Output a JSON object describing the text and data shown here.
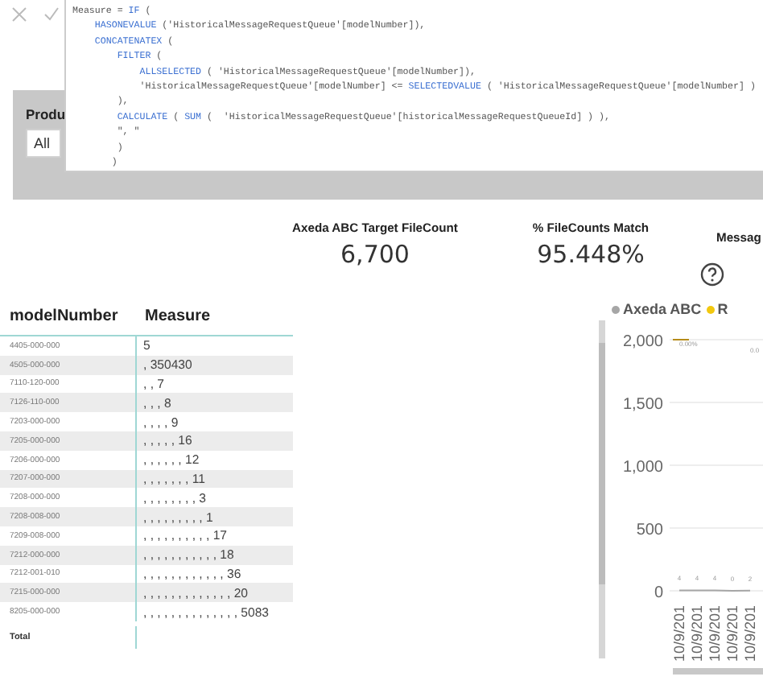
{
  "formula_bar": {
    "code_lines": [
      [
        {
          "kind": "plain",
          "text": "Measure = "
        },
        {
          "kind": "keyword",
          "text": "IF"
        },
        {
          "kind": "plain",
          "text": " ("
        }
      ],
      [
        {
          "kind": "keyword",
          "text": "    HASONEVALUE"
        },
        {
          "kind": "plain",
          "text": " ('HistoricalMessageRequestQueue'[modelNumber]),"
        }
      ],
      [
        {
          "kind": "keyword",
          "text": "    CONCATENATEX"
        },
        {
          "kind": "plain",
          "text": " ("
        }
      ],
      [
        {
          "kind": "keyword",
          "text": "        FILTER"
        },
        {
          "kind": "plain",
          "text": " ("
        }
      ],
      [
        {
          "kind": "keyword",
          "text": "            ALLSELECTED"
        },
        {
          "kind": "plain",
          "text": " ( 'HistoricalMessageRequestQueue'[modelNumber]),"
        }
      ],
      [
        {
          "kind": "plain",
          "text": "            'HistoricalMessageRequestQueue'[modelNumber] <= "
        },
        {
          "kind": "keyword",
          "text": "SELECTEDVALUE"
        },
        {
          "kind": "plain",
          "text": " ( 'HistoricalMessageRequestQueue'[modelNumber] )"
        }
      ],
      [
        {
          "kind": "plain",
          "text": "        ),"
        }
      ],
      [
        {
          "kind": "keyword",
          "text": "        CALCULATE"
        },
        {
          "kind": "plain",
          "text": " ( "
        },
        {
          "kind": "keyword",
          "text": "SUM"
        },
        {
          "kind": "plain",
          "text": " (  'HistoricalMessageRequestQueue'[historicalMessageRequestQueueId] ) ),"
        }
      ],
      [
        {
          "kind": "plain",
          "text": "        \", \""
        }
      ],
      [
        {
          "kind": "plain",
          "text": "        )"
        }
      ],
      [
        {
          "kind": "plain",
          "text": "       )"
        }
      ]
    ]
  },
  "slicer": {
    "title": "Produ",
    "value": "All"
  },
  "cards": [
    {
      "label": "Axeda ABC Target FileCount",
      "value": "6,700"
    },
    {
      "label": "% FileCounts Match",
      "value": "95.448%"
    },
    {
      "label": "Messag"
    }
  ],
  "table": {
    "columns": [
      "modelNumber",
      "Measure"
    ],
    "rows": [
      [
        "4405-000-000",
        "5"
      ],
      [
        "4505-000-000",
        ", 350430"
      ],
      [
        "7110-120-000",
        ", , 7"
      ],
      [
        "7126-110-000",
        ", , , 8"
      ],
      [
        "7203-000-000",
        ", , , , 9"
      ],
      [
        "7205-000-000",
        ", , , , , 16"
      ],
      [
        "7206-000-000",
        ", , , , , , 12"
      ],
      [
        "7207-000-000",
        ", , , , , , , 11"
      ],
      [
        "7208-000-000",
        ", , , , , , , , 3"
      ],
      [
        "7208-008-000",
        ", , , , , , , , , 1"
      ],
      [
        "7209-008-000",
        ", , , , , , , , , , 17"
      ],
      [
        "7212-000-000",
        ", , , , , , , , , , , 18"
      ],
      [
        "7212-001-010",
        ", , , , , , , , , , , , 36"
      ],
      [
        "7215-000-000",
        ", , , , , , , , , , , , , 20"
      ],
      [
        "8205-000-000",
        ", , , , , , , , , , , , , , 5083"
      ]
    ],
    "total_label": "Total"
  },
  "chart": {
    "chart_data": {
      "type": "line",
      "categories": [
        "10/9/201",
        "10/9/201",
        "10/9/201",
        "10/9/201",
        "10/9/201"
      ],
      "grid": true,
      "ylim": [
        0,
        2000
      ],
      "yticks": [
        {
          "value": 0,
          "label": "0"
        },
        {
          "value": 500,
          "label": "500"
        },
        {
          "value": 1000,
          "label": "1,000"
        },
        {
          "value": 1500,
          "label": "1,500"
        },
        {
          "value": 2000,
          "label": "2,000"
        }
      ],
      "series": [
        {
          "name": "Axeda ABC",
          "color": "#a6a6a6",
          "values": [
            4,
            4,
            4,
            0,
            2
          ]
        },
        {
          "name": "R",
          "color": "#f2c80f",
          "values": [
            null,
            null,
            null,
            null,
            null
          ]
        }
      ],
      "data_labels": true,
      "annotations": [
        "0.00%",
        "0.0"
      ]
    }
  }
}
